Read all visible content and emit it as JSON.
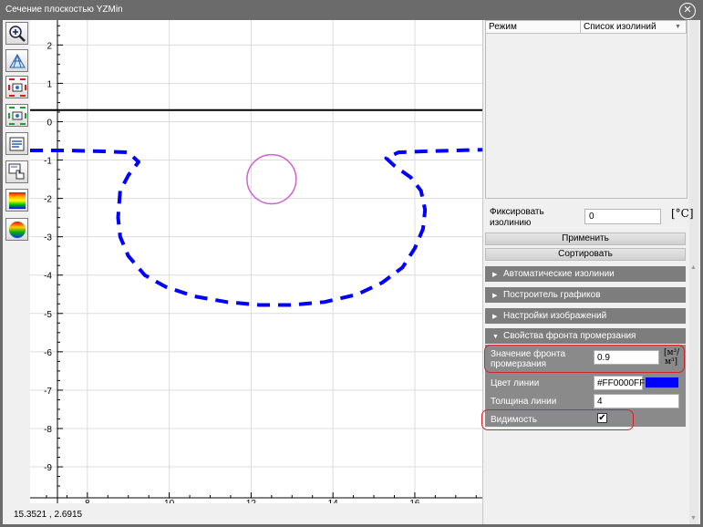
{
  "window": {
    "title": "Сечение плоскостью YZMin",
    "close_glyph": "✕"
  },
  "toolbar": {
    "buttons": [
      {
        "name": "zoom-in-button",
        "icon": "zoom-in-icon"
      },
      {
        "name": "mesh-view-button",
        "icon": "mesh-icon"
      },
      {
        "name": "fit-red-button",
        "icon": "fit-red-icon"
      },
      {
        "name": "fit-green-button",
        "icon": "fit-green-icon"
      },
      {
        "name": "legend-button",
        "icon": "legend-icon"
      },
      {
        "name": "pointer-button",
        "icon": "hand-pointer-icon"
      },
      {
        "name": "palette-button",
        "icon": "color-palette-icon"
      },
      {
        "name": "sphere-button",
        "icon": "color-sphere-icon"
      }
    ]
  },
  "chart_data": {
    "type": "line",
    "x_ticks": [
      8,
      10,
      12,
      14,
      16
    ],
    "y_ticks": [
      2,
      1,
      0,
      -1,
      -2,
      -3,
      -4,
      -5,
      -6,
      -7,
      -8,
      -9
    ],
    "xlim": [
      6.6,
      17.65
    ],
    "ylim": [
      -9.95,
      2.65
    ],
    "series": [
      {
        "style": "solid",
        "color": "#000000",
        "x": [
          6.6,
          17.65
        ],
        "y": [
          0.3,
          0.3
        ]
      },
      {
        "style": "dashed",
        "color": "#0000ff",
        "x": [
          6.6,
          7.5,
          8.3,
          9.0,
          9.25,
          9.0,
          8.8,
          8.75,
          8.8,
          9.0,
          9.4,
          9.9,
          10.6,
          11.4,
          12.2,
          13.0,
          13.8,
          14.6,
          15.2,
          15.7,
          16.0,
          16.2,
          16.25,
          16.15,
          15.9,
          15.5,
          15.3,
          15.6,
          16.3,
          17.0,
          17.65
        ],
        "y": [
          -0.75,
          -0.75,
          -0.77,
          -0.8,
          -1.05,
          -1.4,
          -1.8,
          -2.5,
          -3.0,
          -3.5,
          -4.0,
          -4.3,
          -4.55,
          -4.7,
          -4.78,
          -4.78,
          -4.7,
          -4.5,
          -4.2,
          -3.8,
          -3.3,
          -2.8,
          -2.3,
          -1.8,
          -1.45,
          -1.15,
          -0.95,
          -0.8,
          -0.77,
          -0.75,
          -0.73
        ]
      }
    ],
    "circle": {
      "cx": 12.5,
      "cy": -1.5,
      "r": 0.6,
      "color": "#d060d0"
    }
  },
  "status": {
    "coords": "15.3521 ,  2.6915"
  },
  "panel": {
    "col_mode": "Режим",
    "col_isolines": "Список изолиний",
    "fix_label": "Фиксировать изолинию",
    "fix_value": "0",
    "fix_unit": "[°C]",
    "apply": "Применить",
    "sort": "Сортировать",
    "sections": {
      "auto": "Автоматические изолинии",
      "graph": "Построитель графиков",
      "image": "Настройки изображений",
      "frost": "Свойства фронта промерзания"
    },
    "frost_value_label": "Значение фронта промерзания",
    "frost_value": "0.9",
    "line_color_label": "Цвет линии",
    "line_color_value": "#FF0000FF",
    "line_color": "#0000ff",
    "line_width_label": "Толщина линии",
    "line_width_value": "4",
    "visibility_label": "Видимость",
    "visibility_checked": "✔"
  }
}
